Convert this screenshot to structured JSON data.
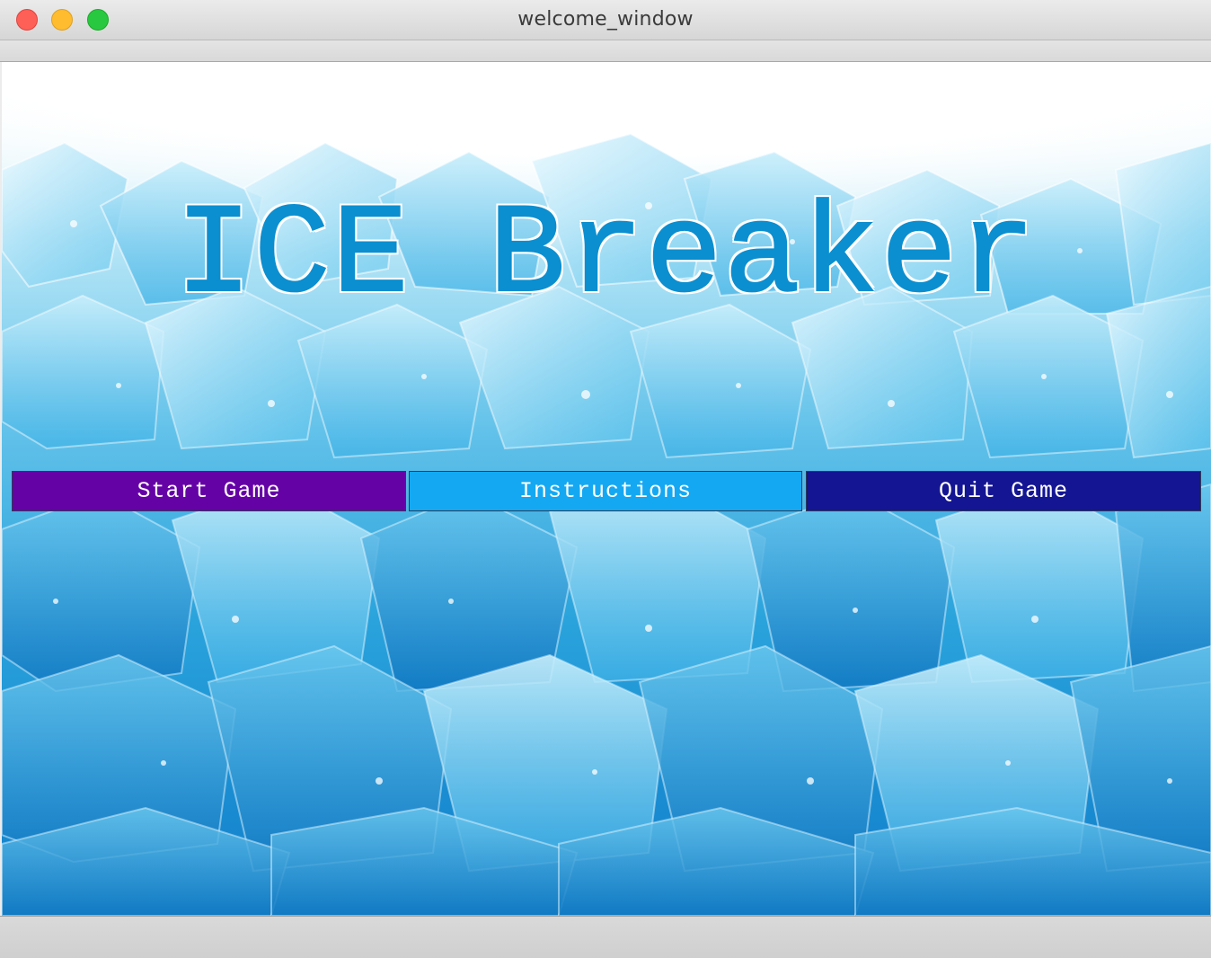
{
  "window": {
    "title": "welcome_window"
  },
  "game": {
    "title": "ICE Breaker"
  },
  "menu": {
    "start_label": "Start Game",
    "instructions_label": "Instructions",
    "quit_label": "Quit Game"
  },
  "colors": {
    "title_text": "#0b8fd0",
    "start_button": "#6502a6",
    "instructions_button": "#15a8f2",
    "quit_button": "#141593"
  }
}
